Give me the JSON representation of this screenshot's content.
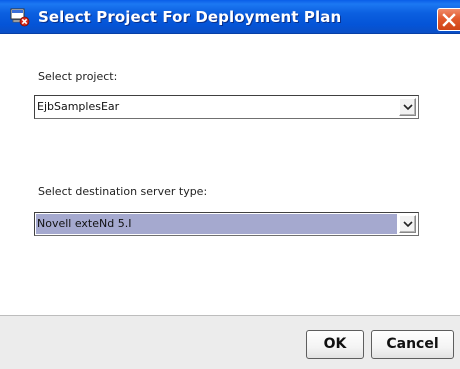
{
  "window": {
    "title": "Select Project For Deployment Plan",
    "title_icon": "deploy-plan-icon",
    "close_icon": "close-icon",
    "titlebar_color": "#0a56dc",
    "close_color": "#e05a2a"
  },
  "project": {
    "label": "Select project:",
    "value": "EjbSamplesEar",
    "dropdown_icon": "chevron-down-icon"
  },
  "server_type": {
    "label": "Select destination server type:",
    "value": "Novell exteNd 5.I",
    "dropdown_icon": "chevron-down-icon",
    "selection_color": "#a5a9cf"
  },
  "buttons": {
    "ok": "OK",
    "cancel": "Cancel"
  }
}
